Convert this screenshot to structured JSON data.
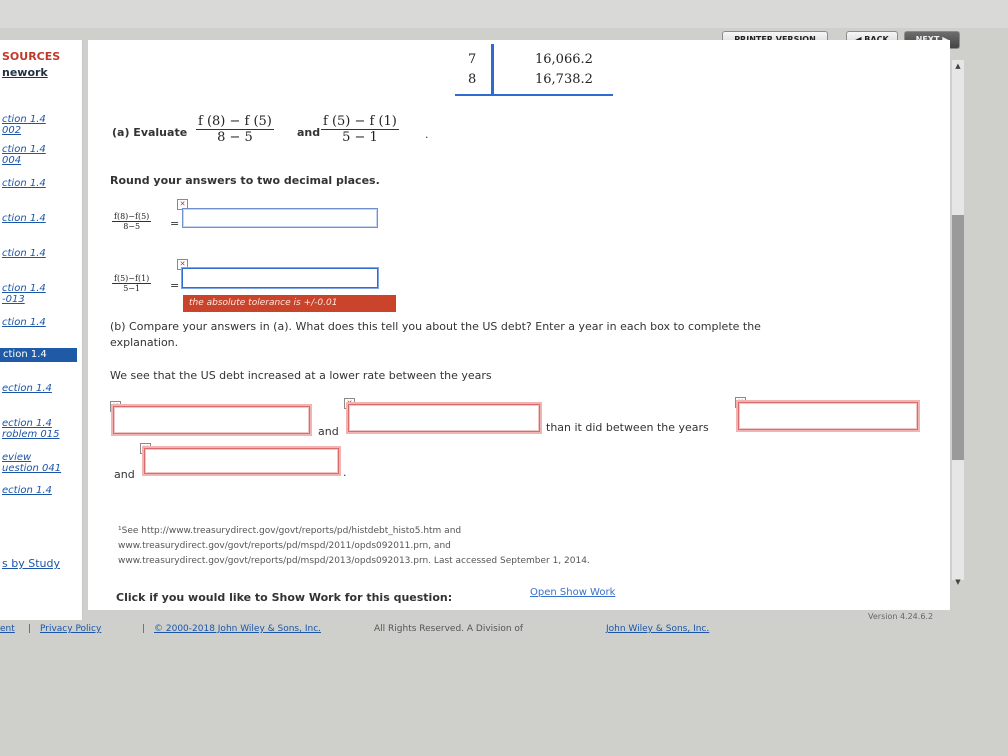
{
  "toolbar": {
    "printer": "PRINTER VERSION",
    "back": "◀ BACK",
    "next": "NEXT ▶"
  },
  "sidebar": {
    "heading1": "SOURCES",
    "heading2": "nework",
    "items": [
      "ction 1.4",
      "002",
      "ction 1.4",
      "004",
      "ction 1.4",
      "ction 1.4",
      "ction 1.4",
      "ction 1.4",
      "-013",
      "ction 1.4",
      "ction 1.4",
      "ection 1.4",
      "ection 1.4",
      "roblem 015",
      "eview",
      "uestion 041",
      "ection 1.4",
      "s by Study"
    ],
    "active": "ction 1.4"
  },
  "table": {
    "rows": [
      {
        "x": "7",
        "y": "16,066.2"
      },
      {
        "x": "8",
        "y": "16,738.2"
      }
    ]
  },
  "part_a": {
    "label": "(a) Evaluate",
    "frac1_num": "f (8) − f (5)",
    "frac1_den": "8 − 5",
    "and": "and",
    "frac2_num": "f (5) − f (1)",
    "frac2_den": "5 − 1",
    "period": ".",
    "instruction": "Round your answers to two decimal places.",
    "small1_num": "f(8)−f(5)",
    "small1_den": "8−5",
    "small2_num": "f(5)−f(1)",
    "small2_den": "5−1",
    "eq": "=",
    "tooltip": "the absolute tolerance is +/-0.01"
  },
  "part_b": {
    "prompt_line1": "(b) Compare your answers in (a). What does this tell you about the US debt? Enter a year in each box to complete the",
    "prompt_line2": "explanation.",
    "sentence": "We see that the US debt increased at a lower rate between the years",
    "and1": "and",
    "than": "than it did between the years",
    "and2": "and",
    "period": "."
  },
  "footnote": {
    "line1": "¹See http://www.treasurydirect.gov/govt/reports/pd/histdebt_histo5.htm and",
    "line2": "www.treasurydirect.gov/govt/reports/pd/mspd/2011/opds092011.prn, and",
    "line3": "www.treasurydirect.gov/govt/reports/pd/mspd/2013/opds092013.prn. Last accessed September 1, 2014."
  },
  "show_work": {
    "label": "Click if you would like to Show Work for this question:",
    "link": "Open Show Work"
  },
  "footer": {
    "left": "ent",
    "sep": "|",
    "privacy": "Privacy Policy",
    "copyright": "© 2000-2018 John Wiley & Sons, Inc.",
    "rights": "All Rights Reserved. A Division of",
    "company": "John Wiley & Sons, Inc.",
    "version": "Version 4.24.6.2"
  }
}
